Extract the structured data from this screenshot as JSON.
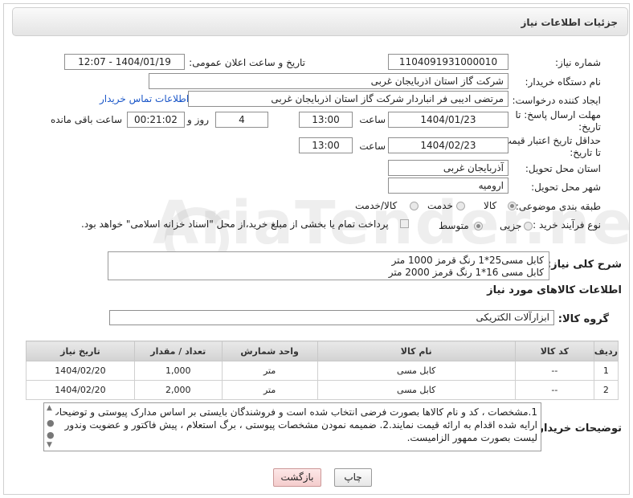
{
  "header": {
    "title": "جزئیات اطلاعات نیاز"
  },
  "need": {
    "number_label": "شماره نیاز:",
    "number": "1104091931000010",
    "announce_label": "تاریخ و ساعت اعلان عمومی:",
    "announce_value": "1404/01/19 - 12:07"
  },
  "buyer": {
    "label": "نام دستگاه خریدار:",
    "value": "شرکت گاز استان اذربایجان غربی"
  },
  "creator": {
    "label": "ایجاد کننده درخواست:",
    "value": "مرتضی ادیبی فر انباردار شرکت گاز استان اذربایجان غربی",
    "contact_link": "اطلاعات تماس خریدار"
  },
  "deadline": {
    "label_line1": "مهلت ارسال پاسخ: تا",
    "label_line2": "تاریخ:",
    "date": "1404/01/23",
    "time_label": "ساعت",
    "time": "13:00",
    "days": "4",
    "days_label": "روز و",
    "remaining": "00:21:02",
    "remaining_label": "ساعت باقی مانده"
  },
  "validity": {
    "label_line1": "حداقل تاریخ اعتبار قیمت:",
    "label_line2": "تا تاریخ:",
    "date": "1404/02/23",
    "time_label": "ساعت",
    "time": "13:00"
  },
  "delivery": {
    "province_label": "استان محل تحویل:",
    "province": "آذربایجان غربی",
    "city_label": "شهر محل تحویل:",
    "city": "ارومیه"
  },
  "category": {
    "label": "طبقه بندی موضوعی:",
    "options": [
      "کالا",
      "خدمت",
      "کالا/خدمت"
    ]
  },
  "process": {
    "label": "نوع فرآیند خرید :",
    "options": [
      "جزیی",
      "متوسط"
    ],
    "payment_note": "پرداخت تمام یا بخشی از مبلغ خرید،از محل \"اسناد خزانه اسلامی\" خواهد بود."
  },
  "general_desc": {
    "label": "شرح کلی نیاز:",
    "line1": "کابل مسی25*1 رنگ قرمز 1000 متر",
    "line2": "کابل مسی 16*1 رنگ قرمز 2000 متر"
  },
  "goods_info": {
    "title": "اطلاعات کالاهای مورد نیاز"
  },
  "goods_group": {
    "label": "گروه کالا:",
    "value": "ابزارآلات الکتریکی"
  },
  "table": {
    "headers": [
      "ردیف",
      "کد کالا",
      "نام کالا",
      "واحد شمارش",
      "تعداد / مقدار",
      "تاریخ نیاز"
    ],
    "rows": [
      [
        "1",
        "--",
        "کابل مسی",
        "متر",
        "1,000",
        "1404/02/20"
      ],
      [
        "2",
        "--",
        "کابل مسی",
        "متر",
        "2,000",
        "1404/02/20"
      ]
    ]
  },
  "buyer_notes": {
    "label": "توضیحات خریدار:",
    "text": "1.مشخصات ، کد و نام کالاها بصورت فرضی انتخاب شده است و فروشندگان بایستی بر اساس مدارک پیوستی و توضیحات ارایه شده اقدام به ارائه قیمت نمایند.2. ضمیمه نمودن مشخصات پیوستی ، برگ استعلام ، پیش فاکتور و عضویت وندور لیست بصورت ممهور الزامیست."
  },
  "buttons": {
    "print": "چاپ",
    "back": "بازگشت"
  },
  "watermark": "AriaTender.neT",
  "colors": {
    "link": "#1a56c8",
    "header_bg": "#e8e8e8"
  }
}
